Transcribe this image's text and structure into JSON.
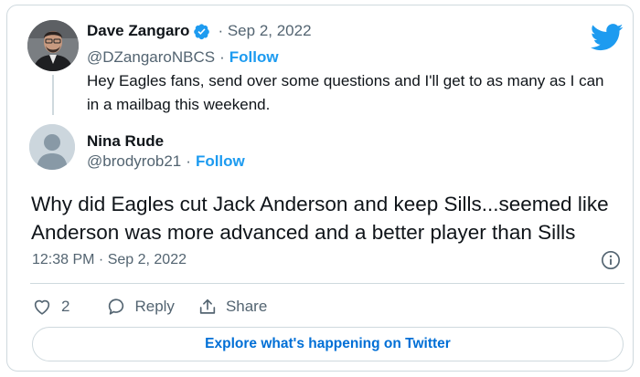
{
  "parent": {
    "name": "Dave Zangaro",
    "date": "Sep 2, 2022",
    "date_separator": "·",
    "handle": "@DZangaroNBCS",
    "follow_label": "Follow",
    "text": "Hey Eagles fans, send over some questions and I'll get to as many as I can in a mailbag this weekend."
  },
  "reply": {
    "name": "Nina Rude",
    "handle": "@brodyrob21",
    "follow_label": "Follow",
    "text": "Why did Eagles cut Jack Anderson and keep Sills...seemed like Anderson was more advanced and a better player than Sills",
    "timestamp": "12:38 PM · Sep 2, 2022"
  },
  "actions": {
    "like_count": "2",
    "reply_label": "Reply",
    "share_label": "Share"
  },
  "explore_label": "Explore what's happening on Twitter",
  "icons": {
    "brand": "twitter-bird-icon",
    "verified": "verified-badge-icon",
    "info": "info-icon",
    "like": "heart-icon",
    "reply": "reply-bubble-icon",
    "share": "share-icon"
  },
  "colors": {
    "accent": "#1d9bf0",
    "link": "#006fd6",
    "text": "#0f1419",
    "secondary": "#536471",
    "border": "#cfd9de"
  }
}
